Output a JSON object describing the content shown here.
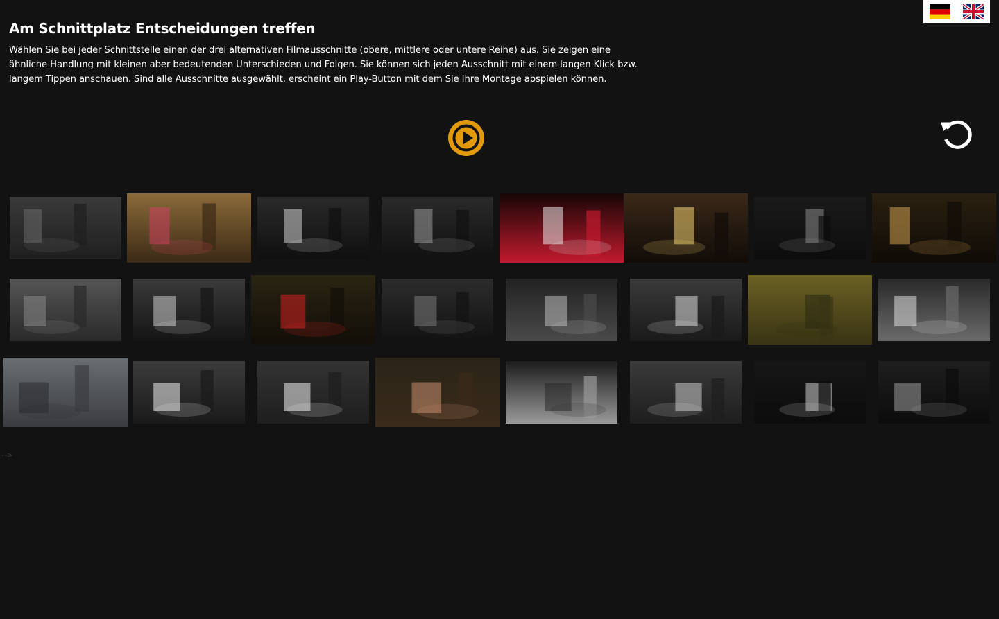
{
  "header": {
    "title": "Am Schnittplatz Entscheidungen treffen",
    "description": "Wählen Sie bei jeder Schnittstelle einen der drei alternativen Filmausschnitte (obere, mittlere oder untere Reihe) aus. Sie zeigen eine ähnliche Handlung mit kleinen aber bedeutenden Unterschieden und Folgen. Sie können sich jeden Ausschnitt mit einem langen Klick bzw. langem Tippen anschauen. Sind alle Ausschnitte ausgewählt, erscheint ein Play-Button mit dem Sie Ihre Montage abspielen können."
  },
  "languages": [
    "de",
    "en"
  ],
  "controls": {
    "play_icon": "play-circle-icon",
    "reset_icon": "reset-icon",
    "accent": "#e39a0a"
  },
  "grid": {
    "selected_rows": [
      3,
      1,
      2,
      3,
      1,
      1,
      2,
      1
    ],
    "rows": [
      [
        "street-archway-motorcycle",
        "reception-desk-flyer",
        "silver-statue-exhibit-hall",
        "hand-on-wall-piano-room",
        "red-crystal-gem",
        "film-studio-equipment",
        "lightbox-corridor",
        "warm-lit-display-cases"
      ],
      [
        "man-hat-street",
        "man-hat-glass-door",
        "red-cloak-exhibit",
        "woman-back-of-head",
        "pedestal-stage-spotlight",
        "camera-crane-studio",
        "man-silhouette-shadow-yellow",
        "display-table-frames"
      ],
      [
        "man-phone-street-color",
        "museum-shop-counter",
        "bright-exhibit-hall",
        "woman-portrait-color",
        "dark-stage-dress-figure",
        "film-set-lamps",
        "illuminated-screen-room",
        "dark-display-shelves"
      ]
    ]
  },
  "stray_text": "-->"
}
